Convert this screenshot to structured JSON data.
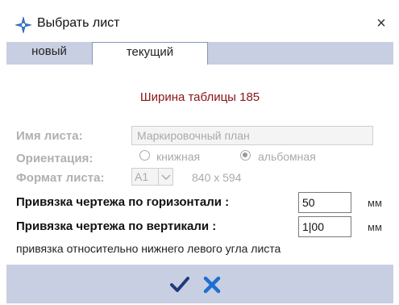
{
  "window": {
    "title": "Выбрать лист",
    "close_label": "×"
  },
  "tabs": [
    {
      "label": "новый"
    },
    {
      "label": "текущий",
      "active": true
    }
  ],
  "table_width_text": "Ширина таблицы 185",
  "sheet_name": {
    "label": "Имя листа:",
    "value": "Маркировочный план"
  },
  "orientation": {
    "label": "Ориентация:",
    "options": [
      {
        "label": "книжная",
        "selected": false
      },
      {
        "label": "альбомная",
        "selected": true
      }
    ]
  },
  "format": {
    "label": "Формат листа:",
    "value": "A1",
    "size": "840 x 594"
  },
  "horizontal": {
    "label": "Привязка чертежа по горизонтали :",
    "value": "50",
    "unit": "мм"
  },
  "vertical": {
    "label": "Привязка чертежа по вертикали :",
    "value": "1|00",
    "unit": "мм"
  },
  "note": "привязка относительно нижнего левого угла листа",
  "colors": {
    "accent": "#1e6fd0",
    "tab_bar": "#c8cfe2",
    "title_red": "#8a1414"
  },
  "icons": {
    "app": "compass-rose-icon",
    "ok": "checkmark-icon",
    "cancel": "x-icon"
  }
}
